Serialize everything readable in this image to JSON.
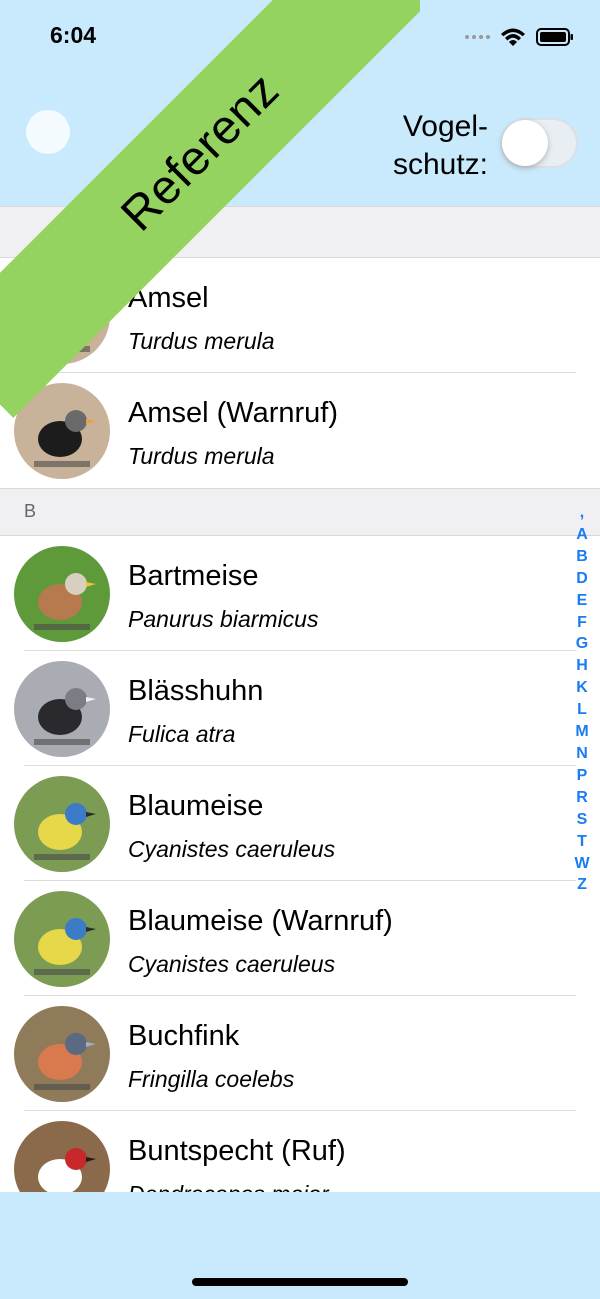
{
  "status": {
    "time": "6:04"
  },
  "header": {
    "toggle_label_line1": "Vogel-",
    "toggle_label_line2": "schutz:",
    "toggle_on": false
  },
  "ribbon": {
    "text": "Referenz"
  },
  "sections": [
    {
      "letter": "",
      "items": [
        {
          "name": "Amsel",
          "latin": "Turdus merula",
          "icon": "blackbird-photo"
        },
        {
          "name": "Amsel (Warnruf)",
          "latin": "Turdus merula",
          "icon": "blackbird-photo"
        }
      ]
    },
    {
      "letter": "B",
      "items": [
        {
          "name": "Bartmeise",
          "latin": "Panurus biarmicus",
          "icon": "bearded-reedling-photo"
        },
        {
          "name": "Blässhuhn",
          "latin": "Fulica atra",
          "icon": "coot-photo"
        },
        {
          "name": "Blaumeise",
          "latin": "Cyanistes caeruleus",
          "icon": "blue-tit-photo"
        },
        {
          "name": "Blaumeise (Warnruf)",
          "latin": "Cyanistes caeruleus",
          "icon": "blue-tit-photo"
        },
        {
          "name": "Buchfink",
          "latin": "Fringilla coelebs",
          "icon": "chaffinch-photo"
        },
        {
          "name": "Buntspecht (Ruf)",
          "latin": "Dendrocopos major",
          "icon": "woodpecker-photo"
        }
      ]
    }
  ],
  "index": [
    ",",
    "A",
    "B",
    "D",
    "E",
    "F",
    "G",
    "H",
    "K",
    "L",
    "M",
    "N",
    "P",
    "R",
    "S",
    "T",
    "W",
    "Z"
  ],
  "colors": {
    "header_bg": "#c9e9fc",
    "ribbon": "#94d35f",
    "index": "#1a7cf2"
  }
}
